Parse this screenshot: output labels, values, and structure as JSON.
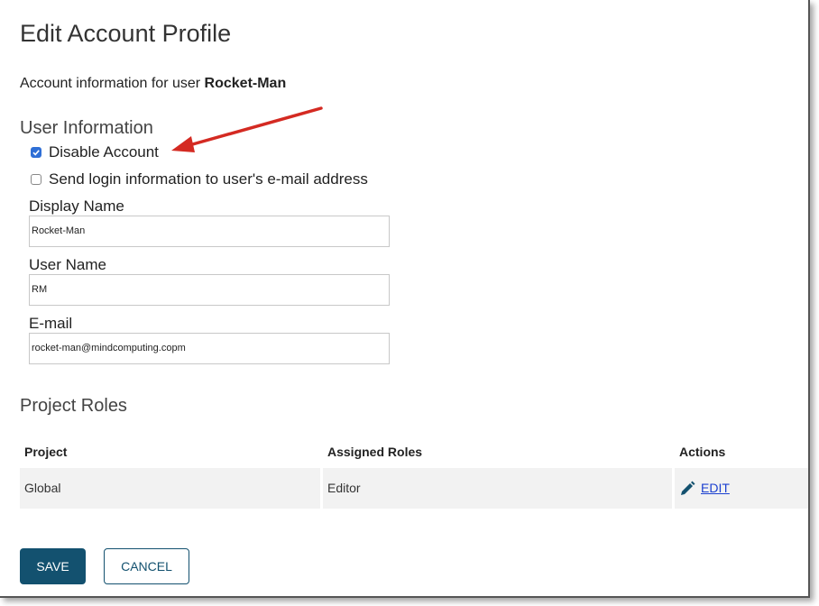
{
  "page": {
    "title": "Edit Account Profile",
    "info_prefix": "Account information for user ",
    "username_bold": "Rocket-Man"
  },
  "user_info": {
    "heading": "User Information",
    "disable_account": {
      "label": "Disable Account",
      "checked": true
    },
    "send_login": {
      "label": "Send login information to user's e-mail address",
      "checked": false
    },
    "display_name": {
      "label": "Display Name",
      "value": "Rocket-Man"
    },
    "user_name": {
      "label": "User Name",
      "value": "RM"
    },
    "email": {
      "label": "E-mail",
      "value": "rocket-man@mindcomputing.copm"
    }
  },
  "roles": {
    "heading": "Project Roles",
    "columns": [
      "Project",
      "Assigned Roles",
      "Actions"
    ],
    "rows": [
      {
        "project": "Global",
        "roles": "Editor",
        "action": "EDIT"
      }
    ]
  },
  "buttons": {
    "save": "SAVE",
    "cancel": "CANCEL"
  },
  "colors": {
    "primary": "#13516f",
    "arrow": "#d42a22",
    "link": "#1a3fd0",
    "checkbox": "#2f6fd6"
  }
}
